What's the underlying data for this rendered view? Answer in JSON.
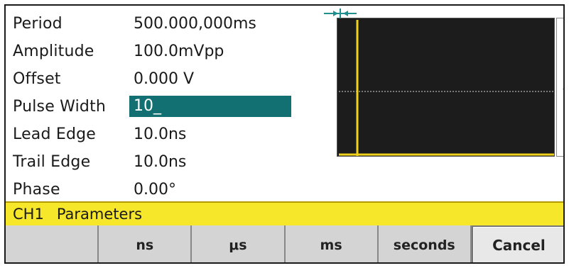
{
  "parameters": [
    {
      "label": "Period",
      "value": "500.000,000ms"
    },
    {
      "label": "Amplitude",
      "value": "100.0mVpp"
    },
    {
      "label": "Offset",
      "value": "0.000 V"
    },
    {
      "label": "Pulse Width",
      "value": "10_",
      "editing": true
    },
    {
      "label": "Lead Edge",
      "value": "10.0ns"
    },
    {
      "label": "Trail Edge",
      "value": "10.0ns"
    },
    {
      "label": "Phase",
      "value": "0.00°"
    }
  ],
  "channel_bar": {
    "channel": "CH1",
    "title": "Parameters"
  },
  "softkeys": [
    "",
    "ns",
    "μs",
    "ms",
    "seconds",
    "Cancel"
  ],
  "colors": {
    "edit_highlight": "#137072",
    "channel_bar": "#f7e72a",
    "waveform": "#f0d21a",
    "scope_background": "#1c1c1c",
    "marker": "#1f8f8f"
  }
}
